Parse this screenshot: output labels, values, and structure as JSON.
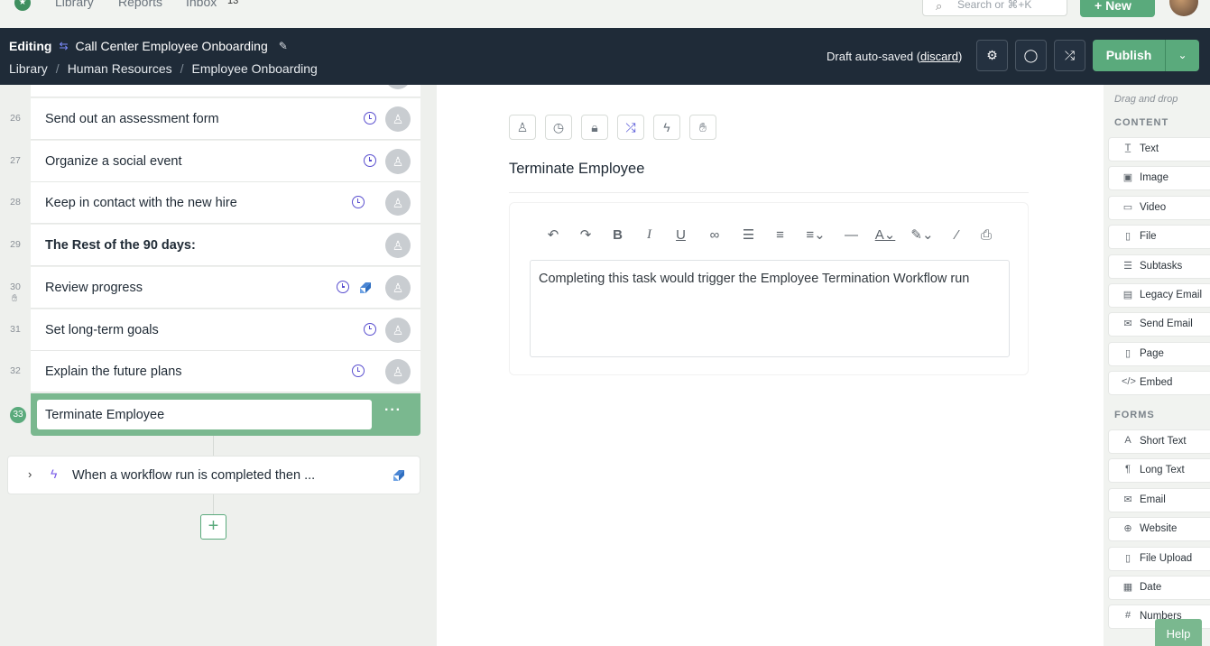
{
  "topnav": {
    "links": [
      "Library",
      "Reports",
      "Inbox"
    ],
    "inbox_count": "13",
    "search_placeholder": "Search or ⌘+K",
    "new_label": "+ New"
  },
  "editbar": {
    "mode": "Editing",
    "workflow_title": "Call Center Employee Onboarding",
    "breadcrumb": [
      "Library",
      "Human Resources",
      "Employee Onboarding"
    ],
    "saved_prefix": "Draft auto-saved (",
    "discard_label": "discard",
    "saved_suffix": ")",
    "publish_label": "Publish"
  },
  "tasks": [
    {
      "num": "26",
      "label": "Send out an assessment form",
      "bold": false,
      "due": true,
      "automation": false,
      "stop": false
    },
    {
      "num": "27",
      "label": "Organize a social event",
      "bold": false,
      "due": true,
      "automation": false,
      "stop": false
    },
    {
      "num": "28",
      "label": "Keep in contact with the new hire",
      "bold": false,
      "due": true,
      "automation": false,
      "stop": false
    },
    {
      "num": "29",
      "label": "The Rest of the 90 days:",
      "bold": true,
      "due": false,
      "automation": false,
      "stop": false
    },
    {
      "num": "30",
      "label": "Review progress",
      "bold": false,
      "due": true,
      "automation": true,
      "stop": true
    },
    {
      "num": "31",
      "label": "Set long-term goals",
      "bold": false,
      "due": true,
      "automation": false,
      "stop": false
    },
    {
      "num": "32",
      "label": "Explain the future plans",
      "bold": false,
      "due": true,
      "automation": false,
      "stop": false
    }
  ],
  "active_task": {
    "num": "33",
    "label": "Terminate Employee"
  },
  "trigger": {
    "label": "When a workflow run is completed then ..."
  },
  "editor": {
    "task_title": "Terminate Employee",
    "body": "Completing this task would trigger the Employee Termination Workflow run"
  },
  "palette": {
    "hint": "Drag and drop",
    "content_heading": "CONTENT",
    "content_items": [
      {
        "icon": "text-icon",
        "glyph": "T̲",
        "label": "Text"
      },
      {
        "icon": "image-icon",
        "glyph": "▣",
        "label": "Image"
      },
      {
        "icon": "video-icon",
        "glyph": "▭",
        "label": "Video"
      },
      {
        "icon": "file-icon",
        "glyph": "▯",
        "label": "File"
      },
      {
        "icon": "subtasks-icon",
        "glyph": "☰",
        "label": "Subtasks"
      },
      {
        "icon": "legacy-email-icon",
        "glyph": "▤",
        "label": "Legacy Email"
      },
      {
        "icon": "send-email-icon",
        "glyph": "✉",
        "label": "Send Email"
      },
      {
        "icon": "page-icon",
        "glyph": "▯",
        "label": "Page"
      },
      {
        "icon": "embed-icon",
        "glyph": "</>",
        "label": "Embed"
      }
    ],
    "forms_heading": "FORMS",
    "form_items": [
      {
        "icon": "short-text-icon",
        "glyph": "A",
        "label": "Short Text"
      },
      {
        "icon": "long-text-icon",
        "glyph": "¶",
        "label": "Long Text"
      },
      {
        "icon": "email-icon",
        "glyph": "✉",
        "label": "Email"
      },
      {
        "icon": "website-icon",
        "glyph": "⊕",
        "label": "Website"
      },
      {
        "icon": "file-upload-icon",
        "glyph": "▯",
        "label": "File Upload"
      },
      {
        "icon": "date-icon",
        "glyph": "▦",
        "label": "Date"
      },
      {
        "icon": "numbers-icon",
        "glyph": "#",
        "label": "Numbers"
      }
    ]
  },
  "help_label": "Help"
}
